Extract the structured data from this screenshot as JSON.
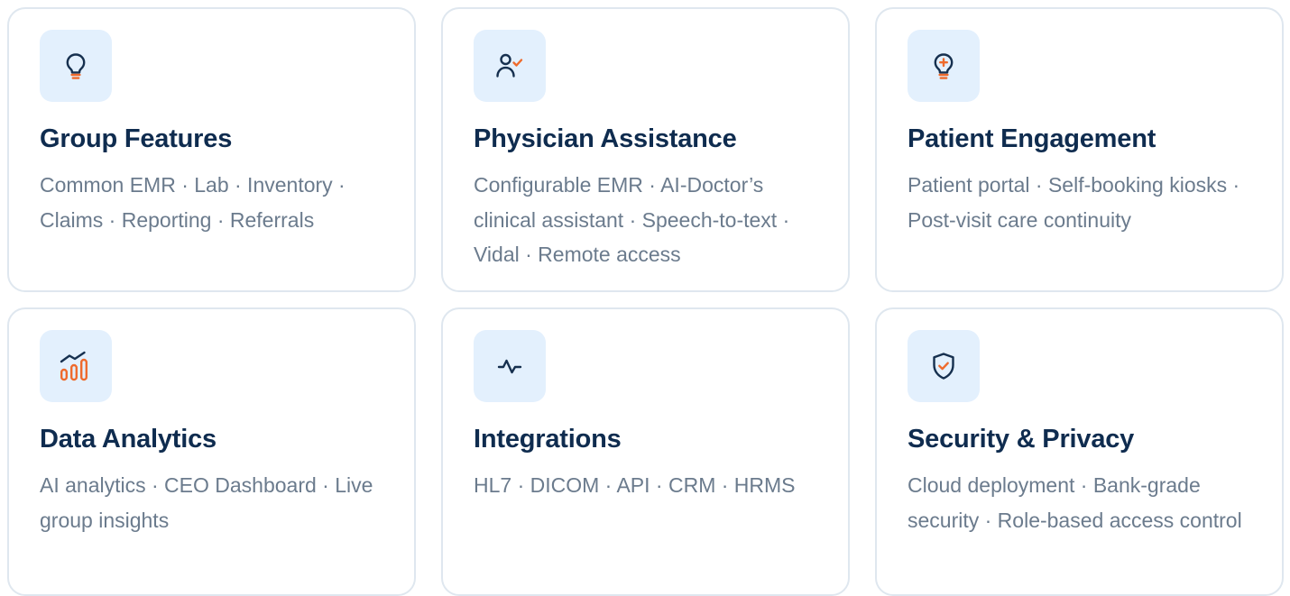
{
  "colors": {
    "title": "#0f2c4f",
    "description": "#6b7b8d",
    "card_border": "#dfe7ef",
    "icon_bg": "#e3f0fd",
    "icon_navy": "#16304f",
    "icon_orange": "#ee6a2c"
  },
  "cards": [
    {
      "icon": "lightbulb-icon",
      "title": "Group Features",
      "description": "Common EMR · Lab · Inventory · Claims · Reporting · Referrals"
    },
    {
      "icon": "user-check-icon",
      "title": "Physician Assistance",
      "description": "Configurable EMR · AI-Doctor’s clinical assistant · Speech-to-text · Vidal · Remote access"
    },
    {
      "icon": "lightbulb-plus-icon",
      "title": "Patient Engagement",
      "description": "Patient portal · Self-booking kiosks · Post-visit care continuity"
    },
    {
      "icon": "chart-trend-icon",
      "title": "Data Analytics",
      "description": "AI analytics · CEO Dashboard · Live group insights"
    },
    {
      "icon": "activity-icon",
      "title": "Integrations",
      "description": "HL7 · DICOM · API · CRM · HRMS"
    },
    {
      "icon": "shield-check-icon",
      "title": "Security & Privacy",
      "description": "Cloud deployment · Bank-grade security · Role-based access control"
    }
  ]
}
